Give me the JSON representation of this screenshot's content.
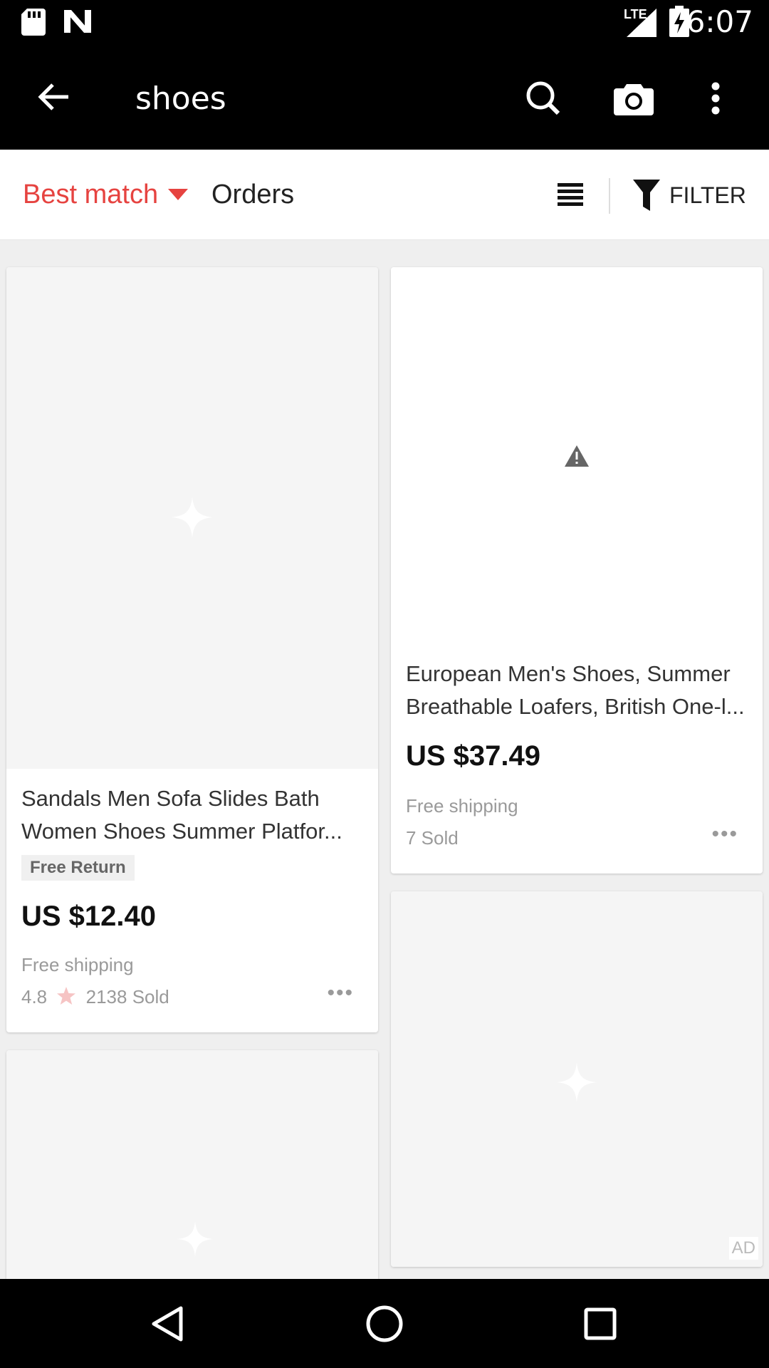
{
  "statusbar": {
    "time": "6:07",
    "network": "LTE"
  },
  "appbar": {
    "query": "shoes"
  },
  "sortbar": {
    "best_match": "Best match",
    "orders": "Orders",
    "filter": "FILTER"
  },
  "products": [
    {
      "title": "Sandals Men Sofa Slides Bath Women Shoes Summer Platfor...",
      "badge": "Free Return",
      "price": "US $12.40",
      "shipping": "Free shipping",
      "rating": "4.8",
      "sold": "2138 Sold"
    },
    {
      "title": "European Men's Shoes, Summer Breathable Loafers, British One-l...",
      "price": "US $37.49",
      "shipping": "Free shipping",
      "sold": "7 Sold"
    }
  ],
  "ad_label": "AD",
  "colors": {
    "accent": "#e64340",
    "bar": "#000000",
    "placeholder": "#f5f5f5"
  }
}
